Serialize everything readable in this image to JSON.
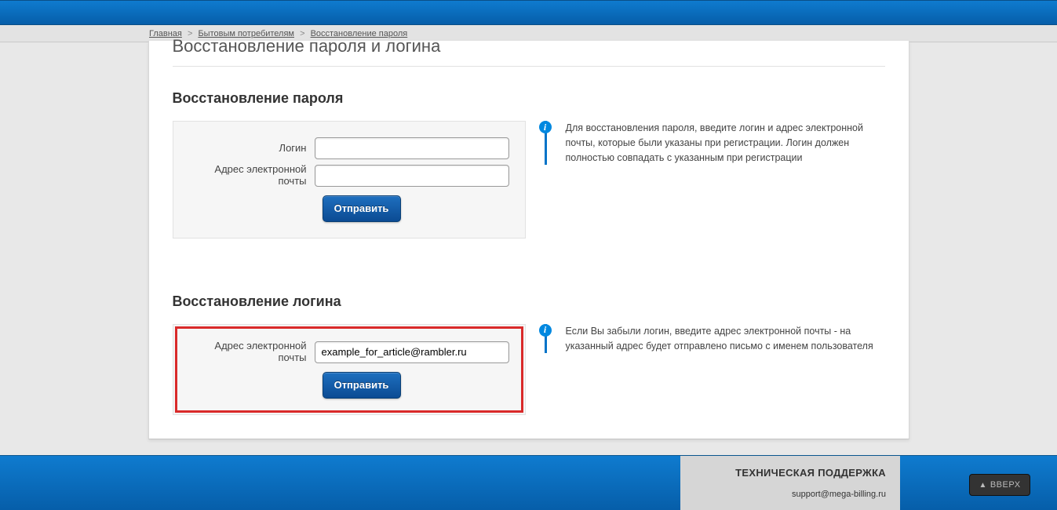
{
  "breadcrumb": {
    "home": "Главная",
    "consumers": "Бытовым потребителям",
    "recovery": "Восстановление пароля"
  },
  "page_title": "Восстановление пароля и логина",
  "password_section": {
    "title": "Восстановление пароля",
    "login_label": "Логин",
    "email_label": "Адрес электронной почты",
    "login_value": "",
    "email_value": "",
    "submit": "Отправить",
    "info": "Для восстановления пароля, введите логин и адрес электронной почты, которые были указаны при регистрации. Логин должен полностью совпадать с указанным при регистрации"
  },
  "login_section": {
    "title": "Восстановление логина",
    "email_label": "Адрес электронной почты",
    "email_value": "example_for_article@rambler.ru",
    "submit": "Отправить",
    "info": "Если Вы забыли логин, введите адрес электронной почты - на указанный адрес будет отправлено письмо с именем пользователя"
  },
  "footer": {
    "tech_support": "ТЕХНИЧЕСКАЯ ПОДДЕРЖКА",
    "email": "support@mega-billing.ru",
    "up": "ВВЕРХ"
  }
}
